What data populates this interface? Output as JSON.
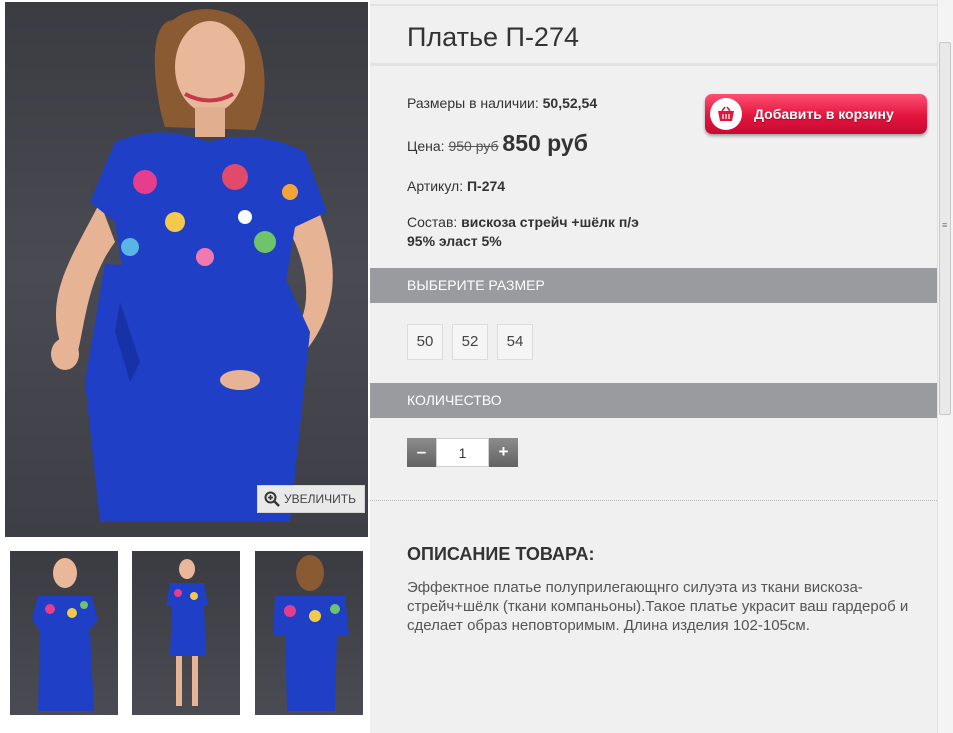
{
  "product": {
    "title": "Платье П-274",
    "sizes_label": "Размеры в наличии:",
    "sizes_value": "50,52,54",
    "price_label": "Цена:",
    "old_price": "950 руб",
    "new_price": "850 руб",
    "article_label": "Артикул:",
    "article_value": "П-274",
    "composition_label": "Состав:",
    "composition_line1": "вискоза стрейч +шёлк п/э",
    "composition_line2": "95% эласт 5%"
  },
  "cart": {
    "label": "Добавить в корзину",
    "icon": "basket-icon"
  },
  "gallery": {
    "zoom_label": "УВЕЛИЧИТЬ",
    "zoom_icon": "zoom-in-icon"
  },
  "size_section": {
    "title": "ВЫБЕРИТЕ РАЗМЕР",
    "options": [
      "50",
      "52",
      "54"
    ]
  },
  "quantity_section": {
    "title": "КОЛИЧЕСТВО",
    "minus": "–",
    "plus": "+",
    "value": "1"
  },
  "description": {
    "title": "ОПИСАНИЕ ТОВАРА:",
    "text": "Эффектное платье полуприлегающнго силуэта из ткани вискоза-стрейч+шёлк (ткани компаньоны).Такое платье украсит ваш гардероб и сделает образ неповторимым. Длина изделия 102-105см."
  },
  "colors": {
    "dress_blue": "#1f3fc6",
    "accent_red": "#e2153e",
    "section_gray": "#9a9b9e",
    "panel_bg": "#f0f0f0"
  }
}
